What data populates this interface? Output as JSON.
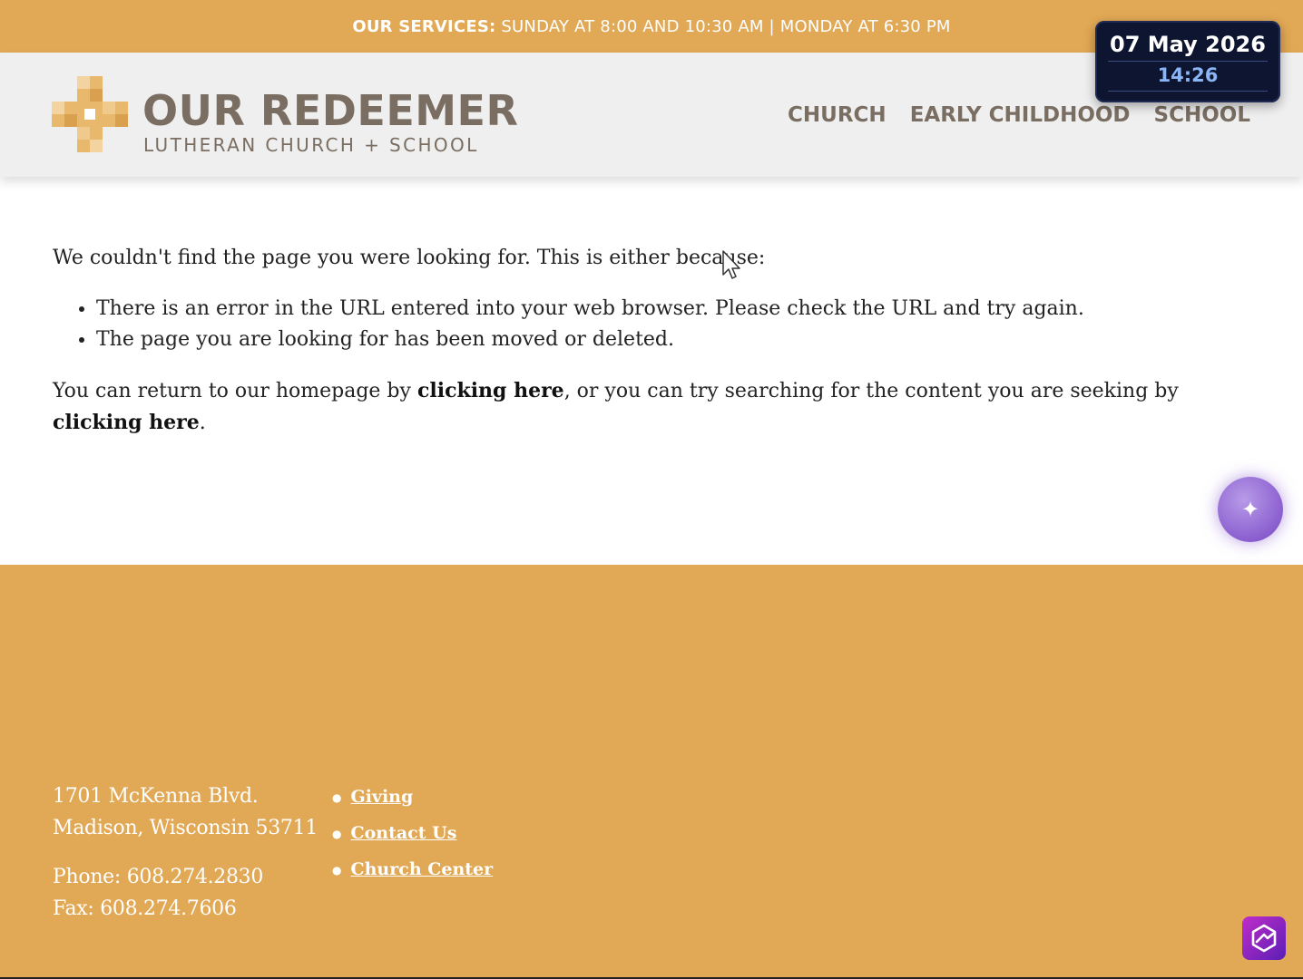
{
  "topbar": {
    "lead": "OUR SERVICES:",
    "text": "SUNDAY AT 8:00 AND 10:30 AM | MONDAY AT 6:30 PM"
  },
  "header": {
    "logo_title": "OUR REDEEMER",
    "logo_subtitle": "LUTHERAN CHURCH + SCHOOL",
    "nav": [
      "CHURCH",
      "EARLY CHILDHOOD",
      "SCHOOL"
    ]
  },
  "clock": {
    "date": "07 May 2026",
    "time": "14:26"
  },
  "main": {
    "intro": "We couldn't find the page you were looking for. This is either because:",
    "bullets": [
      "There is an error in the URL entered into your web browser. Please check the URL and try again.",
      "The page you are looking for has been moved or deleted."
    ],
    "return_prefix": "You can return to our homepage by ",
    "link_home": "clicking here",
    "return_middle": ", or you can try searching for the content you are seeking by ",
    "link_search": "clicking here",
    "return_suffix": "."
  },
  "footer": {
    "address_line1": "1701 McKenna Blvd.",
    "address_line2": "Madison, Wisconsin 53711",
    "phone": "Phone: 608.274.2830",
    "fax": "Fax: 608.274.7606",
    "links": [
      "Giving",
      "Contact Us",
      "Church Center"
    ]
  },
  "colors": {
    "accent": "#E1A855",
    "header_bg": "#EFEFEF",
    "brand_text": "#7A6E62",
    "clock_bg": "#0D1530",
    "clock_time": "#8AB6F5",
    "ai_button": "#8B5FCF"
  },
  "icons": {
    "ai_button": "sparkle-icon",
    "app_icon": "hexagon-logo-icon",
    "cursor": "mouse-pointer-icon"
  }
}
